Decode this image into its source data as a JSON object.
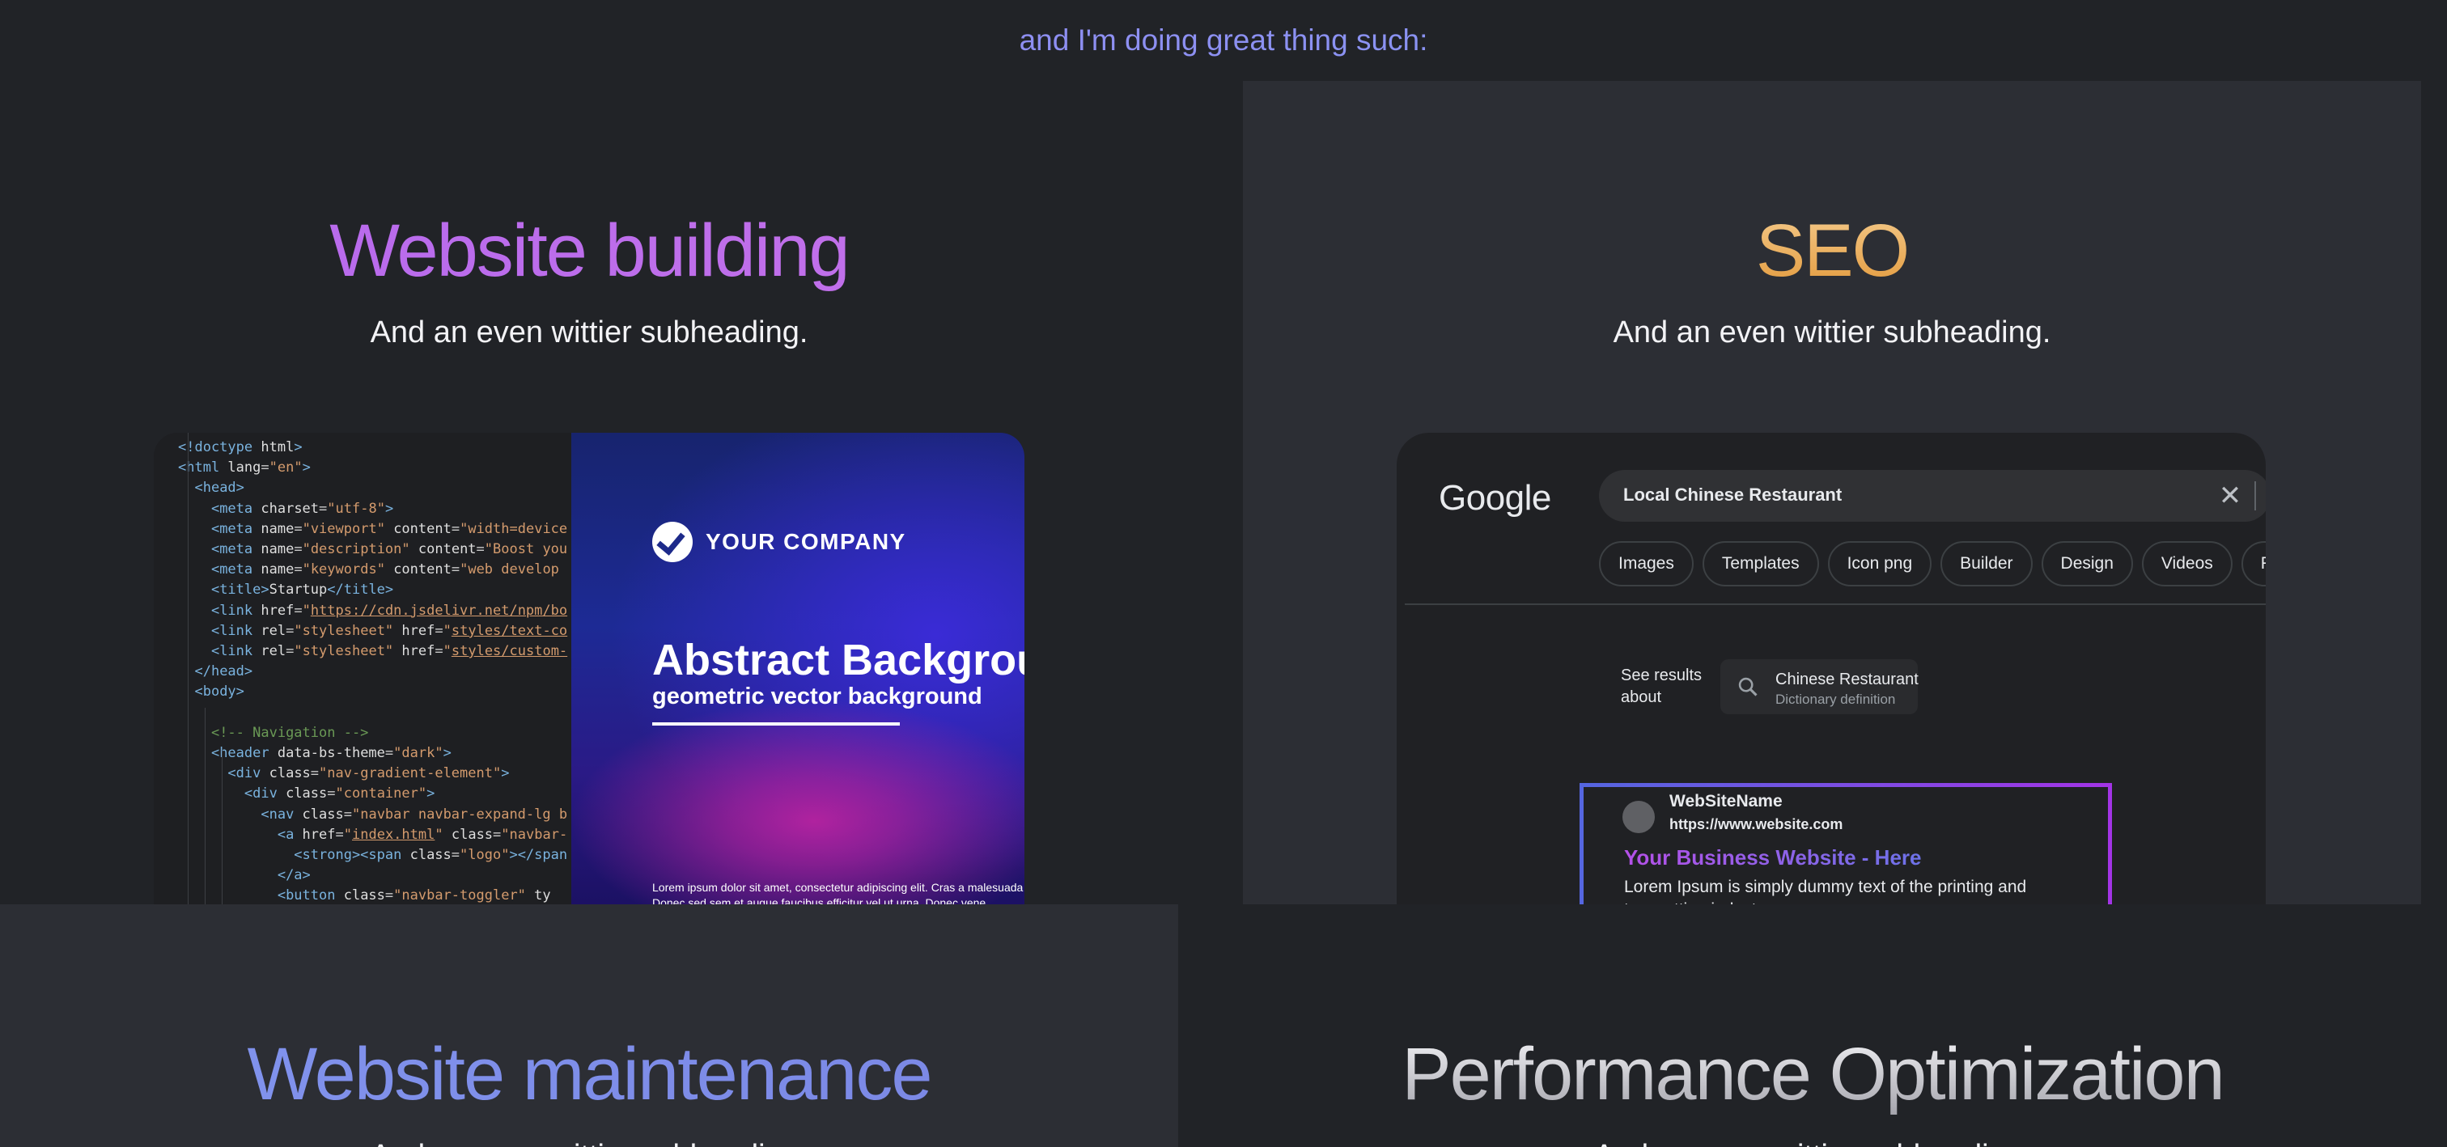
{
  "intro": "and I'm doing great thing such:",
  "services": [
    {
      "title": "Website building",
      "subtitle": "And an even wittier subheading."
    },
    {
      "title": "SEO",
      "subtitle": "And an even wittier subheading."
    },
    {
      "title": "Website maintenance",
      "subtitle": "And an even wittier subheading."
    },
    {
      "title": "Performance Optimization",
      "subtitle": "And an even wittier subheading."
    }
  ],
  "poster": {
    "company": "YOUR COMPANY",
    "title": "Abstract Background",
    "subtitle": "geometric vector background",
    "lorem": "Lorem ipsum dolor sit amet, consectetur adipiscing elit. Cras a malesuada",
    "lorem2": "Donec sed sem et augue faucibus efficitur vel ut urna. Donec vene"
  },
  "google": {
    "logo": "Google",
    "query": "Local Chinese Restaurant",
    "chips": [
      "Images",
      "Templates",
      "Icon png",
      "Builder",
      "Design",
      "Videos",
      "Free"
    ],
    "see_results": "See results about",
    "entity_title": "Chinese Restaurant",
    "entity_sub": "Dictionary definition",
    "result": {
      "site_name": "WebSiteName",
      "url": "https://www.website.com",
      "title": "Your Business Website - Here",
      "description": "Lorem Ipsum is simply dummy text of the printing and typesetting industry."
    }
  },
  "icons": {
    "close": "close-icon",
    "search": "search-icon",
    "logo": "checkmark-logo-icon"
  }
}
